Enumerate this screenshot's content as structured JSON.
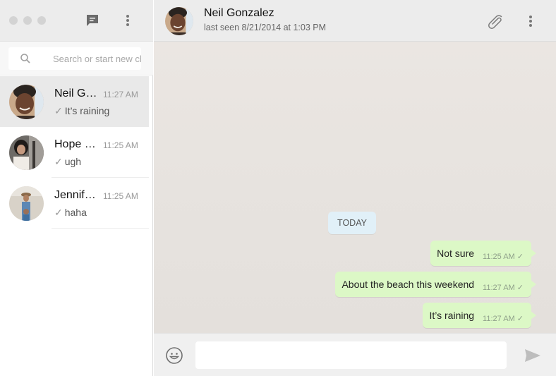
{
  "sidebar": {
    "header": {
      "new_chat_icon": "chat-bubble-icon",
      "menu_icon": "more-vertical-icon"
    },
    "search": {
      "placeholder": "Search or start new ch",
      "icon": "search-icon"
    },
    "chats": [
      {
        "name": "Neil G…",
        "time": "11:27 AM",
        "tick": "✓",
        "preview": "It’s raining",
        "active": true
      },
      {
        "name": "Hope …",
        "time": "11:25 AM",
        "tick": "✓",
        "preview": "ugh",
        "active": false
      },
      {
        "name": "Jennif…",
        "time": "11:25 AM",
        "tick": "✓",
        "preview": "haha",
        "active": false
      }
    ]
  },
  "conversation": {
    "contact_name": "Neil Gonzalez",
    "last_seen": "last seen 8/21/2014 at 1:03 PM",
    "attach_icon": "paperclip-icon",
    "menu_icon": "more-vertical-icon",
    "date_divider": "TODAY",
    "messages": [
      {
        "text": "Not sure",
        "time": "11:25 AM",
        "status": "✓",
        "outgoing": true
      },
      {
        "text": "About the beach this weekend",
        "time": "11:27 AM",
        "status": "✓",
        "outgoing": true
      },
      {
        "text": "It’s raining",
        "time": "11:27 AM",
        "status": "✓",
        "outgoing": true
      }
    ]
  },
  "composer": {
    "input_value": "",
    "emoji_icon": "smiley-icon",
    "send_icon": "send-icon"
  },
  "colors": {
    "outgoing_bubble": "#dcf8c6",
    "date_badge": "#e1f0f8",
    "header_bg": "#ececec",
    "active_chat_bg": "#e9e9e9"
  }
}
